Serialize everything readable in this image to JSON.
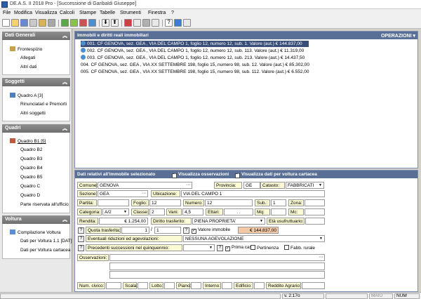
{
  "window": {
    "title": "DE.A.S. II 2018 Pro - [Successione di Garibaldi Giuseppe]"
  },
  "menu": [
    "File",
    "Modifica",
    "Visualizza",
    "Calcoli",
    "Stampe",
    "Tabelle",
    "Strumenti",
    "Finestra",
    "?"
  ],
  "sidebar": {
    "dati_generali": {
      "title": "Dati Generali",
      "items": [
        "Frontespizio",
        "Allegati",
        "Altri dati"
      ]
    },
    "soggetti": {
      "title": "Soggetti",
      "items": [
        "Quadro A [3]",
        "Rinunciatari e Premorti",
        "Altri soggetti"
      ]
    },
    "quadri": {
      "title": "Quadri",
      "items": [
        "Quadro B1 [5]",
        "Quadro B2",
        "Quadro B3",
        "Quadro B4",
        "Quadro B5",
        "Quadro C",
        "Quadro D",
        "Parte riservata all'ufficio"
      ]
    },
    "voltura": {
      "title": "Voltura",
      "items": [
        "Compilazione Voltura",
        "Dati per Voltura 1.1 [DAT]",
        "Dati per Voltura cartacea"
      ]
    }
  },
  "list": {
    "title": "Immobili e diritti reali immobiliari",
    "operations": "OPERAZIONI",
    "rows": [
      "001. CF GENOVA, sez. GEA , VIA DEL CAMPO 1, foglio 12, numero 12, sub. 1. Valore (aut.) € 144.837,00",
      "002. CF GENOVA, sez. GEA , VIA DEL CAMPO 1, foglio 12, numero 12, sub. 113. Valore (aut.) € 11.319,00",
      "003. CF GENOVA, sez. GEA , VIA DEL CAMPO 1, foglio 12, numero 12, sub. 213. Valore (aut.) € 14.437,50",
      "004. CF GENOVA, sez. GEA , VIA XX SETTEMBRE 198, foglio 15, numero 98, sub. 12. Valore (aut.) € 85.302,00",
      "005. CF GENOVA, sez. GEA , VIA XX SETTEMBRE 198, foglio 15, numero 98, sub. 112. Valore (aut.) € 6.552,00"
    ]
  },
  "detail": {
    "title": "Dati relativi all'immobile selezionato",
    "chk_osservazioni": "Visualizza osservazioni",
    "chk_voltura": "Visualizza dati per voltura cartacea",
    "comune_label": "Comune:",
    "comune": "GENOVA",
    "provincia_label": "Provincia:",
    "provincia": "GE",
    "catasto_label": "Catasto:",
    "catasto": "FABBRICATI",
    "sezione_label": "Sezione:",
    "sezione": "GEA",
    "ubicazione_label": "Ubicazione:",
    "ubicazione": "VIA DEL CAMPO 1",
    "partita_label": "Partita:",
    "partita": "",
    "foglio_label": "Foglio:",
    "foglio": "12",
    "numero_label": "Numero:",
    "numero": "12",
    "sub_label": "Sub.:",
    "sub": "1",
    "zona_label": "Zona:",
    "zona": "",
    "categoria_label": "Categoria:",
    "categoria": "A/2",
    "classe_label": "Classe:",
    "classe": "2",
    "vani_label": "Vani:",
    "vani": "4,5",
    "ettari_label": "Ettari:",
    "ettari": ". .",
    "mq_label": "Mq:",
    "mq": "",
    "mc_label": "Mc:",
    "mc": "",
    "rendita_label": "Rendita:",
    "rendita": "€ 1.254,00",
    "diritto_label": "Diritto trasferito:",
    "diritto": "PIENA PROPRIETA'",
    "usufruttuario_label": "Età usufruttuario:",
    "usufruttuario": "",
    "quota_label": "Quota trasferita:",
    "quota_num": "1",
    "quota_sep": "/",
    "quota_den": "1",
    "valore_label": "Valore immobile",
    "valore": "€ 144.837,00",
    "riduzioni_label": "Eventuali riduzioni ed agevolazioni:",
    "riduzioni": "NESSUNA AGEVOLAZIONE",
    "precedenti_label": "Precedenti successioni nel quinquennio:",
    "precedenti": "",
    "prima_casa": "Prima casa",
    "pertinenza": "Pertinenza",
    "fabb_rurale": "Fabb. rurale",
    "osservazioni_label": "Osservazioni:",
    "osservazioni": "",
    "num_civico_label": "Num. civico:",
    "scala_label": "Scala:",
    "lotto_label": "Lotto:",
    "piano_label": "Piano:",
    "interno_label": "Interno:",
    "edificio_label": "Edificio:",
    "reddito_label": "Reddito Agrario:"
  },
  "status": {
    "version": "v. 2.17o",
    "maiu": "MAIU",
    "num": "NUM"
  },
  "colors": {
    "header_bg": "#5a6f96",
    "selected_row": "#3a4e7a",
    "label_bg": "#fafad4",
    "valore_bg": "#f3c9a7"
  }
}
